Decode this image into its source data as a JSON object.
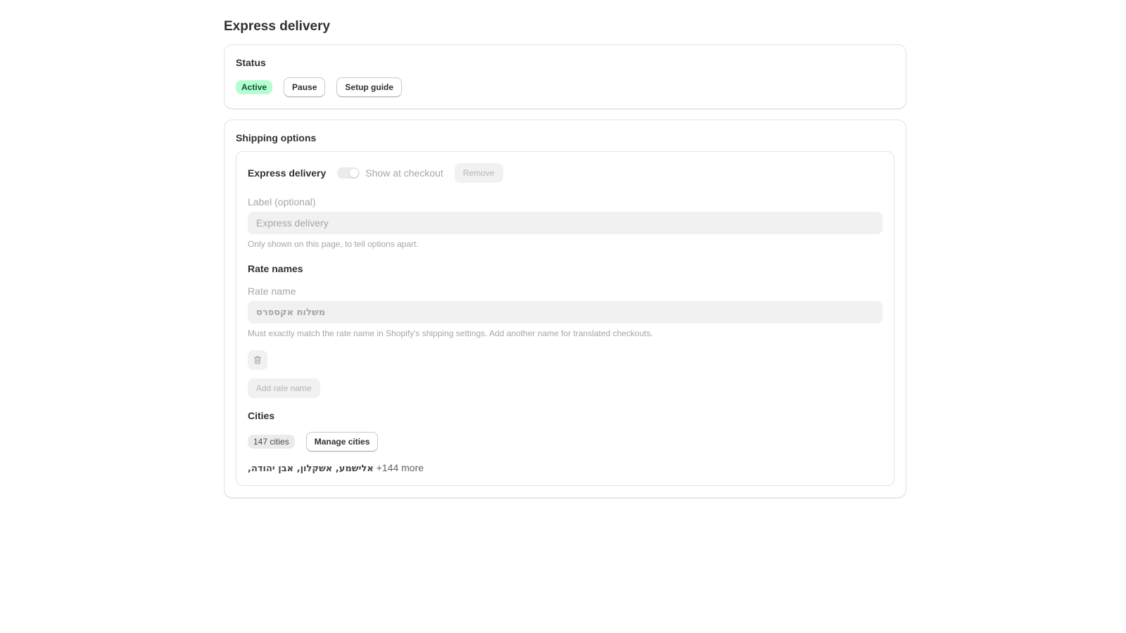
{
  "page": {
    "title": "Express delivery"
  },
  "status": {
    "title": "Status",
    "badge": "Active",
    "pause_label": "Pause",
    "setup_label": "Setup guide",
    "colors": {
      "active_bg": "#b4fed2",
      "active_text": "#0c5132"
    }
  },
  "shipping": {
    "title": "Shipping options",
    "option": {
      "name": "Express delivery",
      "toggle_label": "Show at checkout",
      "toggle_on": false,
      "remove_label": "Remove",
      "label_field": {
        "label": "Label (optional)",
        "placeholder": "Express delivery",
        "help": "Only shown on this page, to tell options apart."
      },
      "rate_names": {
        "title": "Rate names",
        "field_label": "Rate name",
        "placeholder": "משלוח אקספרס",
        "help": "Must exactly match the rate name in Shopify's shipping settings. Add another name for translated checkouts.",
        "delete_icon": "trash-icon",
        "add_label": "Add rate name"
      },
      "cities": {
        "title": "Cities",
        "count_badge": "147 cities",
        "manage_label": "Manage cities",
        "names": "אלישמע, אשקלון, אבן יהודה,",
        "more": "+144 more"
      }
    }
  }
}
